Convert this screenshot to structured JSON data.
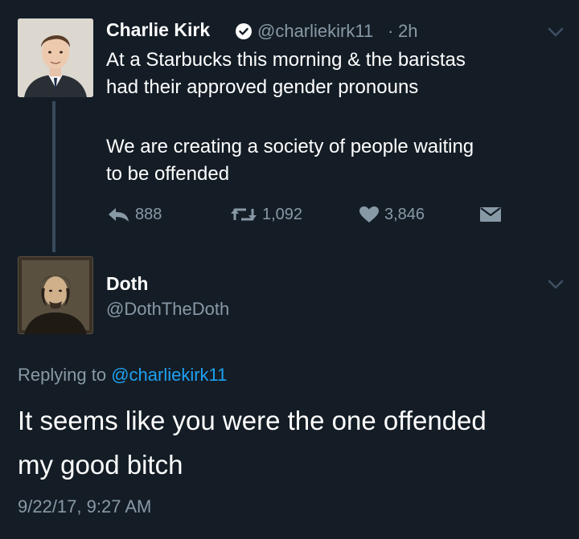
{
  "tweet": {
    "author_name": "Charlie Kirk",
    "handle": "@charliekirk11",
    "separator": "·",
    "time_ago": "2h",
    "text_line1": "At a Starbucks this morning & the baristas",
    "text_line2": "had their approved gender pronouns",
    "text_line3": "We are creating a society of people waiting",
    "text_line4": "to be offended",
    "reply_count": "888",
    "retweet_count": "1,092",
    "like_count": "3,846",
    "icons": {
      "verified": "verified-badge-icon",
      "reply": "reply-arrow-icon",
      "retweet": "retweet-icon",
      "like": "heart-icon",
      "dm": "envelope-icon",
      "menu": "chevron-down-icon"
    }
  },
  "reply": {
    "author_name": "Doth",
    "handle": "@DothTheDoth",
    "replying_prefix": "Replying to",
    "replying_handle": "@charliekirk11",
    "text_line1": "It seems like you were the one offended",
    "text_line2": "my good bitch",
    "timestamp": "9/22/17, 9:27 AM"
  },
  "colors": {
    "background": "#141d26",
    "text": "#ffffff",
    "muted": "#8899a6",
    "link": "#1da1f2",
    "thread_line": "#3a4a5c"
  }
}
